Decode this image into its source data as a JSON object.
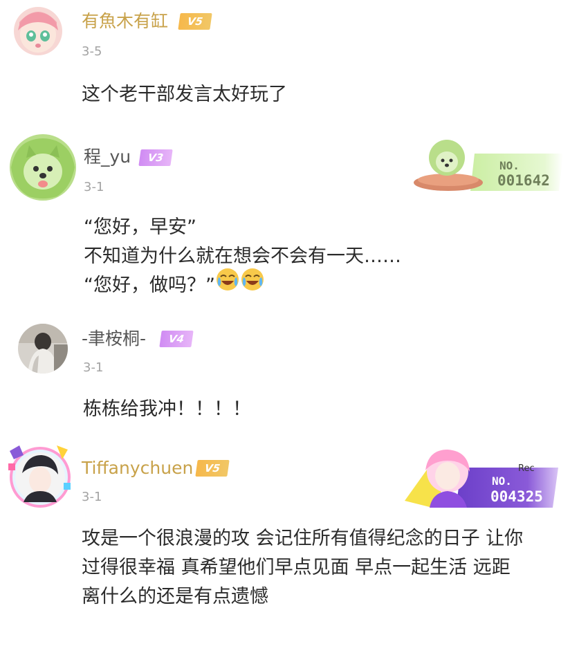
{
  "colors": {
    "username_gold": "#c8a24a",
    "username_gray": "#555555",
    "date": "#a3a3a3",
    "text": "#2b2b2b"
  },
  "comments": [
    {
      "username": "有魚木有缸",
      "vip": "V5",
      "date": "3-5",
      "lines": [
        "这个老干部发言太好玩了"
      ]
    },
    {
      "username": "程_yu",
      "vip": "V3",
      "date": "3-1",
      "badge": {
        "no": "NO.",
        "number": "001642"
      },
      "lines": [
        "“您好，早安”",
        "不知道为什么就在想会不会有一天……",
        "“您好，做吗？”"
      ],
      "emojis": [
        "laugh-cry-icon",
        "laugh-cry-icon"
      ]
    },
    {
      "username": "-聿桉桐-",
      "vip": "V4",
      "date": "3-1",
      "lines": [
        "栋栋给我冲！！！！"
      ]
    },
    {
      "username": "Tiffanychuen",
      "vip": "V5",
      "date": "3-1",
      "badge": {
        "no": "NO.",
        "number": "004325",
        "tag": "Rec"
      },
      "lines": [
        "攻是一个很浪漫的攻 会记住所有值得纪念的日子 让你",
        "过得很幸福 真希望他们早点见面 早点一起生活 远距",
        "离什么的还是有点遗憾"
      ]
    }
  ]
}
